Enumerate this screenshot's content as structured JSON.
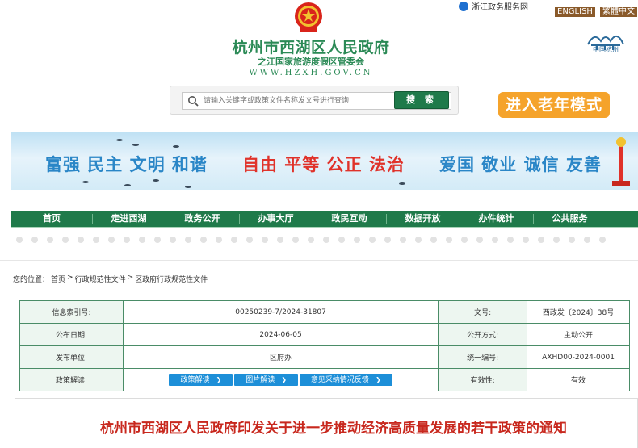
{
  "header": {
    "site_title": "杭州市西湖区人民政府",
    "site_subtitle": "之江国家旅游度假区管委会",
    "site_url": "WWW.HZXH.GOV.CN",
    "gov_service": "浙江政务服务网",
    "lang_en": "ENGLISH",
    "lang_tc": "繁體中文",
    "city_logo_label": "中国杭州"
  },
  "search": {
    "placeholder": "请输入关键字或政策文件名称发文号进行查询",
    "button": "搜 索"
  },
  "elder_mode": "进入老年模式",
  "banner": {
    "slogan1": "富强 民主 文明 和谐",
    "slogan2": "自由 平等 公正 法治",
    "slogan3": "爱国 敬业 诚信 友善"
  },
  "nav": [
    "首页",
    "走进西湖",
    "政务公开",
    "办事大厅",
    "政民互动",
    "数据开放",
    "办件统计",
    "公共服务"
  ],
  "breadcrumb": {
    "prefix": "您的位置：",
    "items": [
      "首页",
      "行政规范性文件",
      "区政府行政规范性文件"
    ],
    "sep": ">"
  },
  "info": {
    "index_label": "信息索引号:",
    "index_value": "00250239-7/2024-31807",
    "doc_no_label": "文号:",
    "doc_no_value": "西政发〔2024〕38号",
    "date_label": "公布日期:",
    "date_value": "2024-06-05",
    "open_label": "公开方式:",
    "open_value": "主动公开",
    "unit_label": "发布单位:",
    "unit_value": "区府办",
    "unified_label": "统一编号:",
    "unified_value": "AXHD00-2024-0001",
    "interp_label": "政策解读:",
    "interp_buttons": [
      "政策解读",
      "图片解读",
      "意见采纳情况反馈"
    ],
    "validity_label": "有效性:",
    "validity_value": "有效"
  },
  "article": {
    "title": "杭州市西湖区人民政府印发关于进一步推动经济高质量发展的若干政策的通知"
  },
  "colors": {
    "brand_green": "#1f7a4a",
    "title_red": "#c8281e",
    "elder_orange": "#f5a32b",
    "pill_blue": "#1d8fd8"
  }
}
